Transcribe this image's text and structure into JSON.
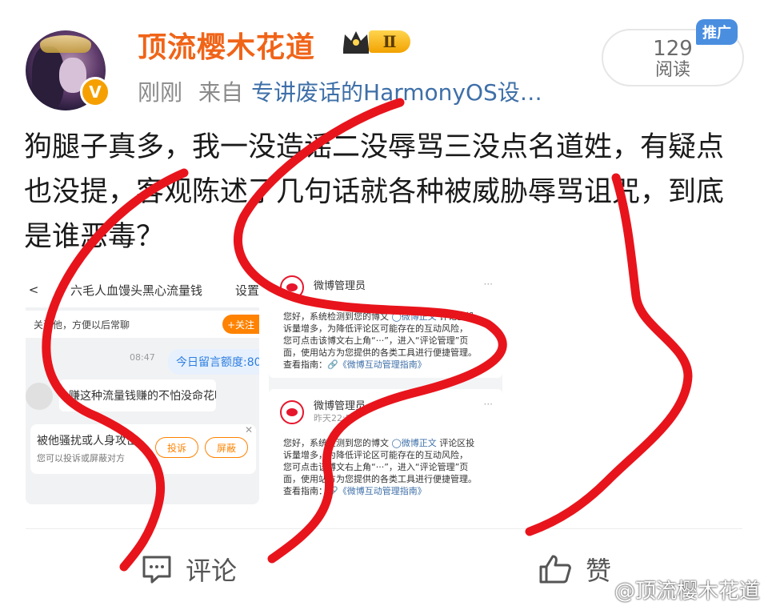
{
  "post": {
    "username": "顶流樱木花道",
    "level": "Ⅱ",
    "time": "刚刚",
    "from_label": "来自",
    "source": "专讲废话的HarmonyOS设…",
    "reads_count": "129",
    "reads_label": "阅读",
    "ad_tag": "推广",
    "content_text": "狗腿子真多，我一没造谣二没辱骂三没点名道姓，有疑点也没提，客观陈述了几句话就各种被威胁辱骂诅咒，到底是谁恶毒？"
  },
  "screenshot1": {
    "back": "<",
    "title": "六毛人血馒头黑心流量钱",
    "settings": "设置",
    "follow_tip": "关注他，方便以后常聊",
    "follow_btn": "+关注",
    "time": "08:47",
    "quota": "今日留言额度:80",
    "message": "赚这种流量钱赚的不怕没命花吗",
    "card_title": "被他骚扰或人身攻击",
    "card_desc": "您可以投诉或屏蔽对方",
    "report_btn": "投诉",
    "block_btn": "屏蔽",
    "close": "✕"
  },
  "screenshot2": {
    "admin_name": "微博管理员",
    "more": "···",
    "card_b_time": "昨天22:50",
    "body_line1": "您好，系统检测到您的博文",
    "body_link1": "◯微博正文",
    "body_line1b": "评论区投",
    "body_line2": "诉量增多，为降低评论区可能存在的互动风险，",
    "body_line3": "您可点击该博文右上角“···”，进入“评论管理”页",
    "body_line4": "面，使用站方为您提供的各类工具进行便捷管理。",
    "guide_label": "查看指南：",
    "guide_link": "🔗《微博互动管理指南》"
  },
  "actions": {
    "comment": "评论",
    "like": "赞"
  },
  "watermark": "@顶流樱木花道",
  "colors": {
    "username": "#f06418",
    "link": "#3e6fa8",
    "scribble": "#e8141c",
    "ad_tag": "#4a8ee0"
  }
}
